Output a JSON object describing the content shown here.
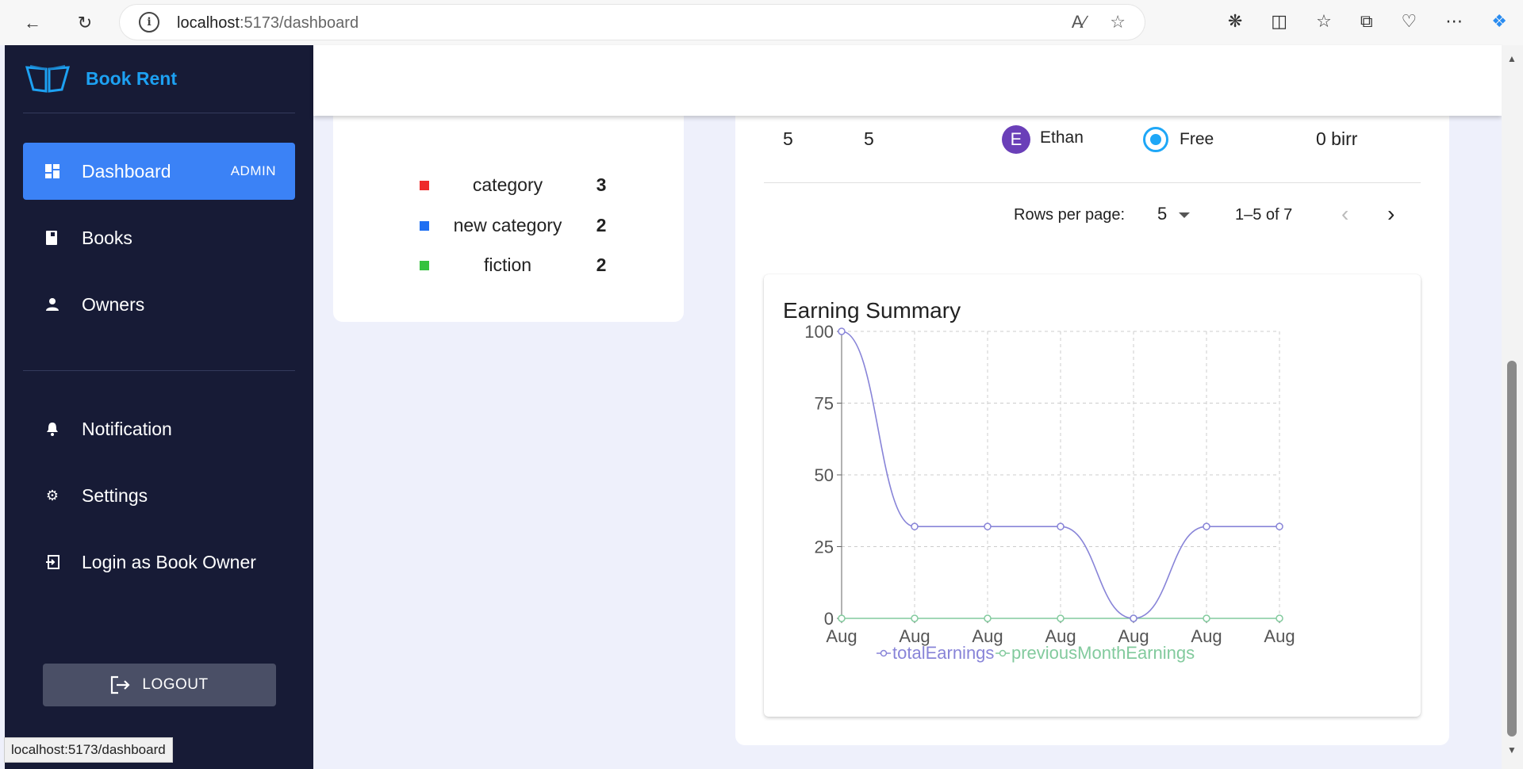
{
  "browser": {
    "url_host": "localhost",
    "url_path": ":5173/dashboard"
  },
  "sidebar": {
    "brand": "Book Rent",
    "items": [
      {
        "label": "Dashboard",
        "badge": "ADMIN",
        "icon": "dashboard-icon",
        "active": true
      },
      {
        "label": "Books",
        "icon": "book-icon"
      },
      {
        "label": "Owners",
        "icon": "person-icon"
      },
      {
        "label": "Notification",
        "icon": "bell-icon"
      },
      {
        "label": "Settings",
        "icon": "gear-icon"
      },
      {
        "label": "Login as Book Owner",
        "icon": "login-icon"
      }
    ],
    "logout_label": "LOGOUT"
  },
  "categories_legend": [
    {
      "name": "category",
      "count": "3",
      "color": "#ee2b2b"
    },
    {
      "name": "new category",
      "count": "2",
      "color": "#1f6ff2"
    },
    {
      "name": "fiction",
      "count": "2",
      "color": "#36c23f"
    }
  ],
  "table": {
    "row": {
      "col1": "5",
      "col2": "5",
      "avatar_initial": "E",
      "owner": "Ethan",
      "status": "Free",
      "price": "0 birr"
    },
    "pagination": {
      "rows_per_page_label": "Rows per page:",
      "rows_per_page_value": "5",
      "range": "1–5 of 7"
    }
  },
  "chart_data": {
    "type": "line",
    "title": "Earning Summary",
    "categories": [
      "Aug",
      "Aug",
      "Aug",
      "Aug",
      "Aug",
      "Aug",
      "Aug"
    ],
    "series": [
      {
        "name": "totalEarnings",
        "values": [
          100,
          32,
          32,
          32,
          0,
          32,
          32
        ],
        "color": "#8884d8"
      },
      {
        "name": "previousMonthEarnings",
        "values": [
          0,
          0,
          0,
          0,
          0,
          0,
          0
        ],
        "color": "#82ca9d"
      }
    ],
    "ylim": [
      0,
      100
    ],
    "yticks": [
      0,
      25,
      50,
      75,
      100
    ],
    "grid": true,
    "legend": "bottom-center"
  },
  "status_tooltip": "localhost:5173/dashboard"
}
